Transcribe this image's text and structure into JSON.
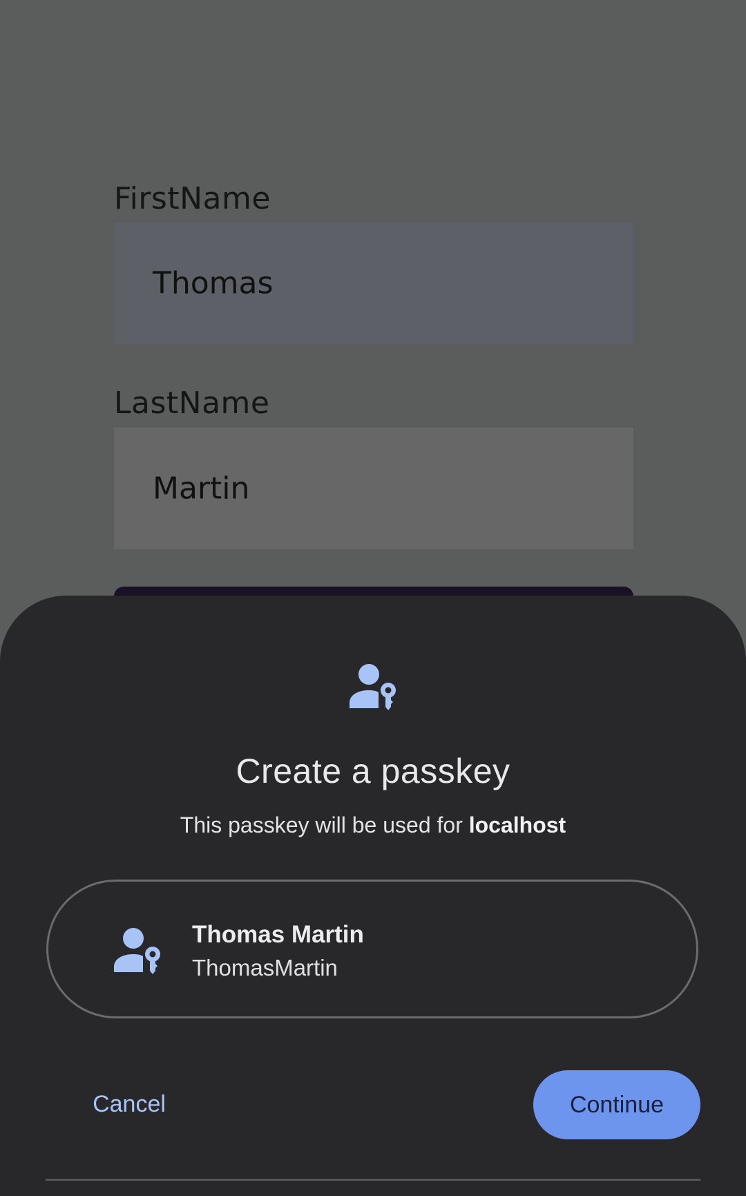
{
  "form": {
    "first_name_label": "FirstName",
    "first_name_value": "Thomas",
    "last_name_label": "LastName",
    "last_name_value": "Martin"
  },
  "sheet": {
    "icon": "passkey-person-key-icon",
    "title": "Create a passkey",
    "subtitle_prefix": "This passkey will be used for ",
    "subtitle_domain": "localhost",
    "account": {
      "icon": "passkey-person-key-icon",
      "display_name": "Thomas Martin",
      "username": "ThomasMartin"
    },
    "cancel_label": "Cancel",
    "continue_label": "Continue"
  },
  "colors": {
    "sheet_background": "#28282b",
    "accent": "#6d95ee",
    "link_text": "#a8c3f5",
    "icon_color": "#a8c3f5",
    "scrim": "#5b5c5c"
  }
}
